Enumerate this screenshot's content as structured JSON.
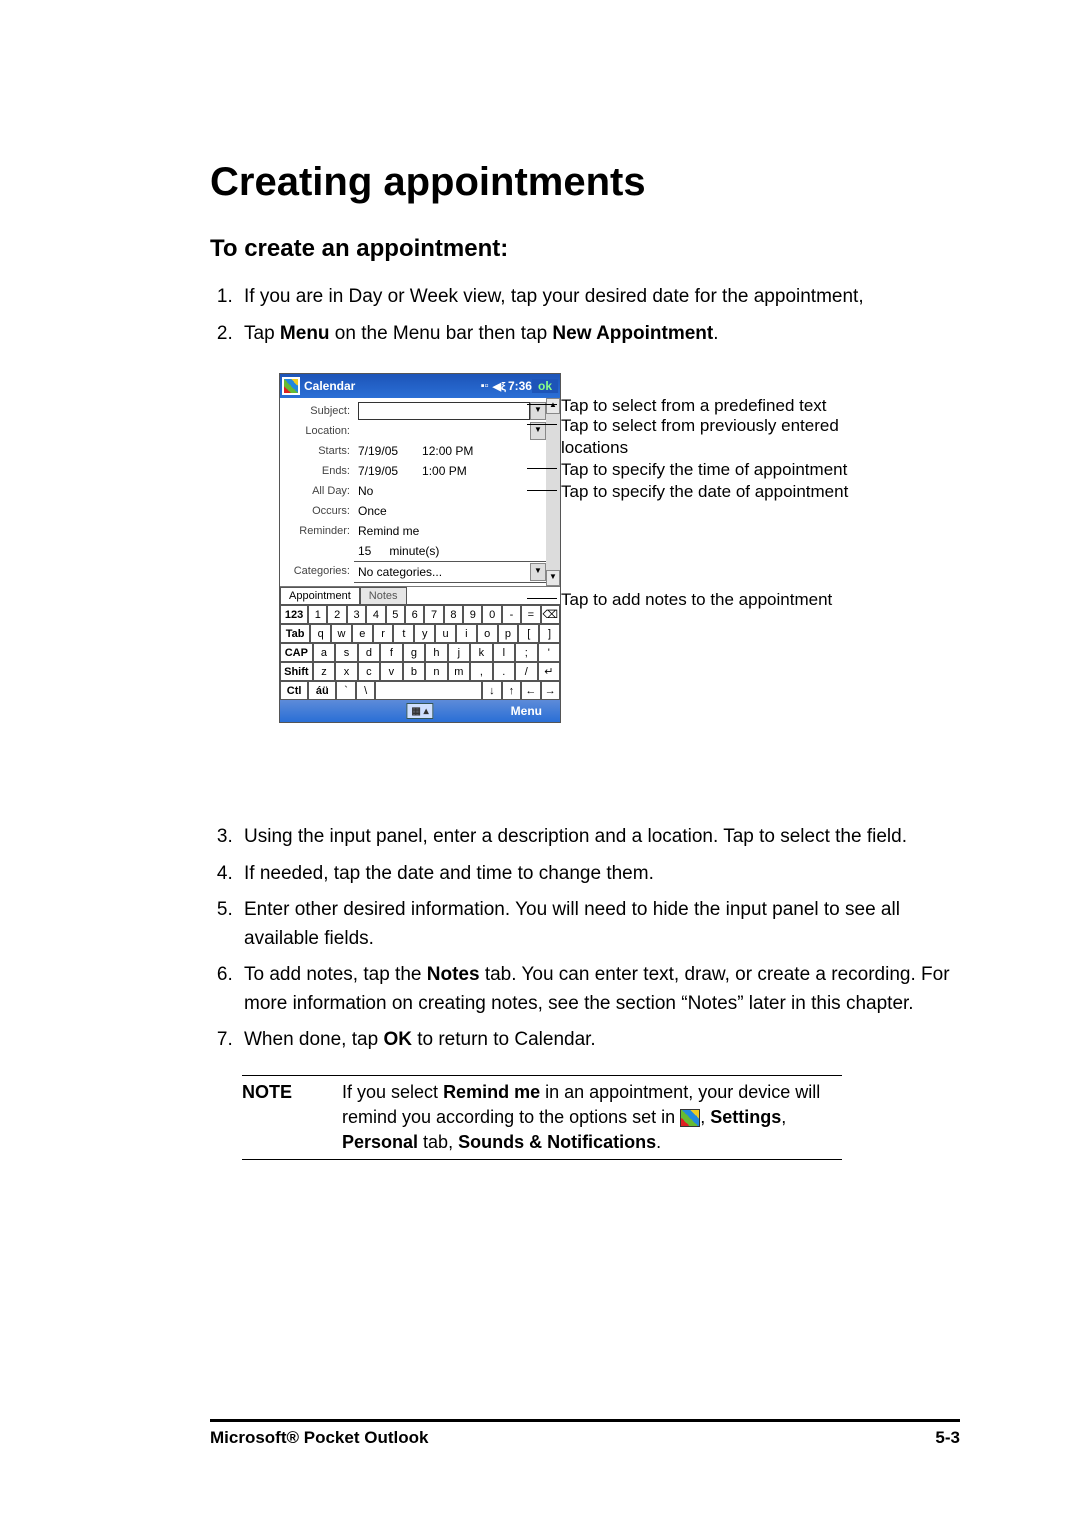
{
  "headings": {
    "h1": "Creating appointments",
    "h2": "To create an appointment:"
  },
  "steps_a": [
    {
      "n": "1.",
      "text": "If you are in Day or Week view, tap your desired date for the appointment,"
    },
    {
      "n": "2.",
      "pre": "Tap ",
      "b1": "Menu",
      "mid": " on the Menu bar then tap ",
      "b2": "New Appointment",
      "post": "."
    }
  ],
  "device": {
    "title": "Calendar",
    "time": "7:36",
    "ok": "ok",
    "labels": {
      "subject": "Subject:",
      "location": "Location:",
      "starts": "Starts:",
      "ends": "Ends:",
      "allday": "All Day:",
      "occurs": "Occurs:",
      "reminder": "Reminder:",
      "categories": "Categories:"
    },
    "values": {
      "starts_date": "7/19/05",
      "starts_time": "12:00 PM",
      "ends_date": "7/19/05",
      "ends_time": "1:00 PM",
      "allday": "No",
      "occurs": "Once",
      "reminder": "Remind me",
      "rem_num": "15",
      "rem_unit": "minute(s)",
      "categories": "No categories..."
    },
    "tabs": {
      "appt": "Appointment",
      "notes": "Notes"
    },
    "keys": {
      "r1": [
        "123",
        "1",
        "2",
        "3",
        "4",
        "5",
        "6",
        "7",
        "8",
        "9",
        "0",
        "-",
        "=",
        "⌫"
      ],
      "r2": [
        "Tab",
        "q",
        "w",
        "e",
        "r",
        "t",
        "y",
        "u",
        "i",
        "o",
        "p",
        "[",
        "]"
      ],
      "r3": [
        "CAP",
        "a",
        "s",
        "d",
        "f",
        "g",
        "h",
        "j",
        "k",
        "l",
        ";",
        "'"
      ],
      "r4": [
        "Shift",
        "z",
        "x",
        "c",
        "v",
        "b",
        "n",
        "m",
        ",",
        ".",
        "/",
        "↵"
      ],
      "r5": [
        "Ctl",
        "áü",
        "`",
        "\\",
        " ",
        "↓",
        "↑",
        "←",
        "→"
      ]
    },
    "menu": "Menu"
  },
  "callouts": {
    "c1": "Tap to select from a predefined text",
    "c2": "Tap to select from previously entered locations",
    "c3": "Tap to specify the time of appointment",
    "c4": "Tap to specify the date of appointment",
    "c5": "Tap to add notes to the appointment"
  },
  "steps_b": [
    {
      "n": "3.",
      "text": "Using the input panel, enter a description and a location. Tap to select the field."
    },
    {
      "n": "4.",
      "text": "If needed, tap the date and time to change them."
    },
    {
      "n": "5.",
      "text": "Enter other desired information. You will need to hide the input panel to see all available fields."
    },
    {
      "n": "6.",
      "pre": "To add notes, tap the ",
      "b1": "Notes",
      "post": " tab. You can enter text, draw, or create a recording. For more information on creating notes, see the section “Notes” later in this chapter."
    },
    {
      "n": "7.",
      "pre": "When done, tap ",
      "b1": "OK",
      "post": " to return to Calendar."
    }
  ],
  "note": {
    "label": "NOTE",
    "t1": "If you select ",
    "b1": "Remind me",
    "t2": " in an appointment, your device will remind you according to the options set in ",
    "t3": ", ",
    "b2": "Settings",
    "t4": ", ",
    "b3": "Personal",
    "t5": " tab, ",
    "b4": "Sounds & Notifications",
    "t6": "."
  },
  "footer": {
    "left": "Microsoft® Pocket Outlook",
    "right": "5-3"
  }
}
